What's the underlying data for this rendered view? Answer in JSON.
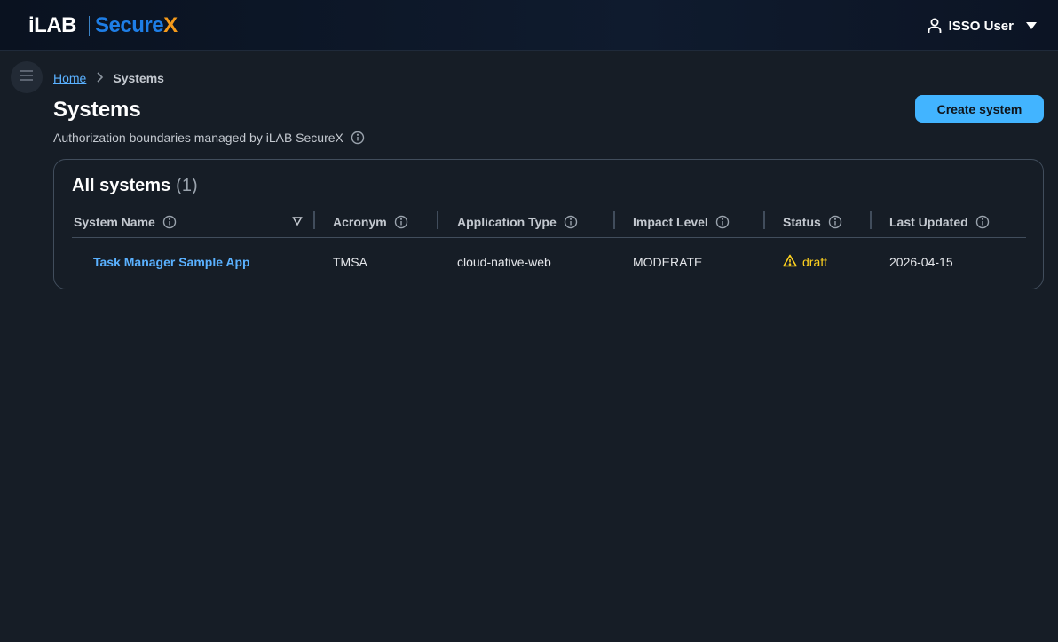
{
  "nav": {
    "logo_left": "iLAB",
    "logo_secure": "Secure",
    "logo_x": "X",
    "user_name": "ISSO User",
    "icons": [
      "user-icon",
      "caret-down-icon"
    ]
  },
  "breadcrumb": {
    "home": "Home",
    "current": "Systems"
  },
  "page": {
    "title": "Systems",
    "description": "Authorization boundaries managed by iLAB SecureX",
    "create_button": "Create system"
  },
  "table": {
    "header_title": "All systems",
    "header_count": "(1)",
    "columns": [
      "System Name",
      "Acronym",
      "Application Type",
      "Impact Level",
      "Status",
      "Last Updated"
    ],
    "rows": [
      {
        "system_name": "Task Manager Sample App",
        "acronym": "TMSA",
        "application_type": "cloud-native-web",
        "impact_level": "MODERATE",
        "status": "draft",
        "last_updated": "2026-04-15"
      }
    ]
  },
  "colors": {
    "accent": "#42b4ff",
    "link": "#5ab1ff",
    "warning": "#ffd21f",
    "brand_blue": "#1e7ee6",
    "brand_orange": "#f59a1b",
    "background": "#161d26"
  }
}
